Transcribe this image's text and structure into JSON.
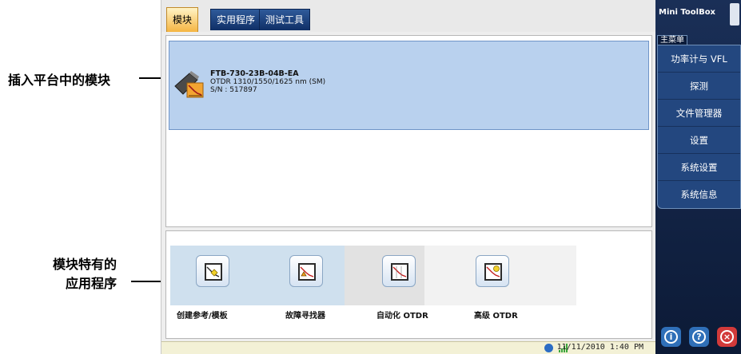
{
  "callouts": {
    "module_inserted": "插入平台中的模块",
    "module_apps_line1": "模块特有的",
    "module_apps_line2": "应用程序"
  },
  "tabs": [
    {
      "label": "模块",
      "active": true
    },
    {
      "label": "实用程序",
      "active": false
    },
    {
      "label": "测试工具",
      "active": false
    }
  ],
  "module": {
    "name": "FTB-730-23B-04B-EA",
    "description": "OTDR 1310/1550/1625 nm (SM)",
    "serial": "S/N : 517897",
    "icon": "otdr-module-icon"
  },
  "apps": [
    {
      "label": "创建参考/模板",
      "icon": "reference-template-icon"
    },
    {
      "label": "故障寻找器",
      "icon": "fault-finder-icon"
    },
    {
      "label": "自动化 OTDR",
      "icon": "auto-otdr-icon"
    },
    {
      "label": "高级 OTDR",
      "icon": "advanced-otdr-icon"
    }
  ],
  "status": {
    "datetime": "11/11/2010 1:40 PM"
  },
  "sidebar": {
    "title": "Mini ToolBox",
    "section": "主菜单",
    "items": [
      {
        "label": "功率计与 VFL"
      },
      {
        "label": "探测"
      },
      {
        "label": "文件管理器"
      },
      {
        "label": "设置"
      },
      {
        "label": "系统设置"
      },
      {
        "label": "系统信息"
      }
    ],
    "buttons": [
      {
        "icon": "info-icon",
        "glyph": "i",
        "color": "#2f6fb8"
      },
      {
        "icon": "help-icon",
        "glyph": "?",
        "color": "#2f6fb8"
      },
      {
        "icon": "close-icon",
        "glyph": "×",
        "color": "#d23a3a"
      }
    ]
  },
  "colors": {
    "active_tab": "#f5b542",
    "module_highlight": "#b9d1ee",
    "sidebar_bg": "#1a2f57"
  }
}
